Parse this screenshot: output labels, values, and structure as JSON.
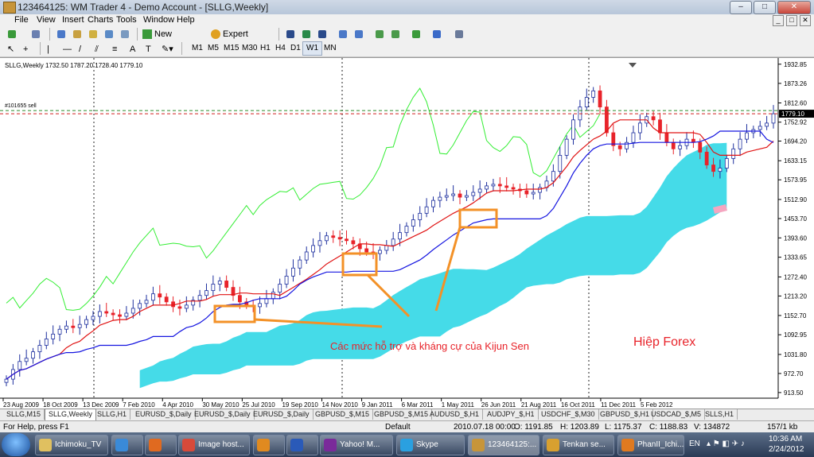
{
  "window": {
    "title": "123464125: WM Trader 4 - Demo Account - [SLLG,Weekly]",
    "buttons": [
      "–",
      "□",
      "✕"
    ]
  },
  "menu": [
    "File",
    "View",
    "Insert",
    "Charts",
    "Tools",
    "Window",
    "Help"
  ],
  "mdi_buttons": [
    "_",
    "□",
    "✕"
  ],
  "toolbar": {
    "new_order": "New Order",
    "expert_advisors": "Expert Advisors"
  },
  "drawing_tools": {
    "text_tool": "A"
  },
  "timeframes": [
    "M1",
    "M5",
    "M15",
    "M30",
    "H1",
    "H4",
    "D1",
    "W1",
    "MN"
  ],
  "active_timeframe": "W1",
  "chart": {
    "header": "SLLG,Weekly  1732.50 1787.20 1728.40 1779.10",
    "order_label": "#101655 sell",
    "price_tag": "1779.10",
    "annotation": "Các mức hỗ trợ và kháng cự của Kijun Sen",
    "watermark": "Hiệp Forex",
    "colors": {
      "up": "#1d2f9e",
      "down": "#e8232a",
      "kijun": "#1515e0",
      "tenkan": "#e01414",
      "chikou": "#33ee33",
      "cloud": "#45dbe8",
      "cloud_end": "#f5a6c0",
      "highlight": "#f39127"
    }
  },
  "chart_data": {
    "type": "candlestick",
    "title": "SLLG,Weekly",
    "y_ticks": [
      1932.85,
      1873.26,
      1812.6,
      1752.92,
      1694.2,
      1633.15,
      1573.95,
      1512.9,
      1453.7,
      1393.6,
      1333.65,
      1272.4,
      1213.2,
      1152.7,
      1092.95,
      1031.8,
      972.7,
      913.5
    ],
    "x_ticks": [
      "23 Aug 2009",
      "18 Oct 2009",
      "13 Dec 2009",
      "7 Feb 2010",
      "4 Apr 2010",
      "30 May 2010",
      "25 Jul 2010",
      "19 Sep 2010",
      "14 Nov 2010",
      "9 Jan 2011",
      "6 Mar 2011",
      "1 May 2011",
      "26 Jun 2011",
      "21 Aug 2011",
      "16 Oct 2011",
      "11 Dec 2011",
      "5 Feb 2012"
    ],
    "ylim": [
      896,
      1952
    ],
    "last_ohlc": {
      "open": 1732.5,
      "high": 1787.2,
      "low": 1728.4,
      "close": 1779.1
    },
    "order_line_price": 1779.1,
    "close_series": [
      955,
      985,
      1010,
      1020,
      1040,
      1060,
      1080,
      1095,
      1110,
      1120,
      1115,
      1125,
      1140,
      1150,
      1165,
      1160,
      1155,
      1150,
      1160,
      1175,
      1190,
      1200,
      1220,
      1210,
      1195,
      1180,
      1175,
      1185,
      1200,
      1215,
      1230,
      1250,
      1260,
      1240,
      1215,
      1195,
      1185,
      1180,
      1190,
      1205,
      1225,
      1250,
      1275,
      1300,
      1325,
      1350,
      1370,
      1385,
      1400,
      1395,
      1390,
      1385,
      1375,
      1360,
      1350,
      1345,
      1355,
      1370,
      1390,
      1410,
      1430,
      1450,
      1470,
      1490,
      1510,
      1520,
      1525,
      1530,
      1520,
      1525,
      1535,
      1545,
      1555,
      1560,
      1555,
      1550,
      1545,
      1540,
      1530,
      1535,
      1550,
      1570,
      1600,
      1650,
      1700,
      1760,
      1800,
      1830,
      1850,
      1800,
      1720,
      1680,
      1670,
      1690,
      1720,
      1750,
      1770,
      1760,
      1720,
      1690,
      1670,
      1680,
      1700,
      1690,
      1660,
      1620,
      1600,
      1610,
      1640,
      1670,
      1700,
      1720,
      1730,
      1740,
      1750,
      1779
    ]
  },
  "tabs": [
    "SLLG,M15",
    "SLLG,Weekly",
    "SLLG,H1",
    "EURUSD_$,Daily",
    "EURUSD_$,Daily",
    "EURUSD_$,Daily",
    "GBPUSD_$,M15",
    "GBPUSD_$,M15",
    "AUDUSD_$,H1",
    "AUDJPY_$,H1",
    "USDCHF_$,M30",
    "GBPUSD_$,H1",
    "USDCAD_$,M5",
    "SLLS,H1"
  ],
  "status": {
    "help": "For Help, press F1",
    "profile": "Default",
    "datetime": "2010.07.18 00:00",
    "open": "O: 1191.85",
    "high": "H: 1203.89",
    "low": "L: 1175.37",
    "close": "C: 1188.83",
    "volume": "V: 134872",
    "traffic": "157/1 kb"
  },
  "taskbar": {
    "items": [
      "Ichimoku_TV",
      "",
      "",
      "Image host...",
      "",
      "",
      "Yahoo! M...",
      "Skype",
      "123464125:...",
      "Tenkan se...",
      "PhanII_Ichi..."
    ],
    "lang": "EN",
    "time": "10:36 AM",
    "date": "2/24/2012"
  }
}
